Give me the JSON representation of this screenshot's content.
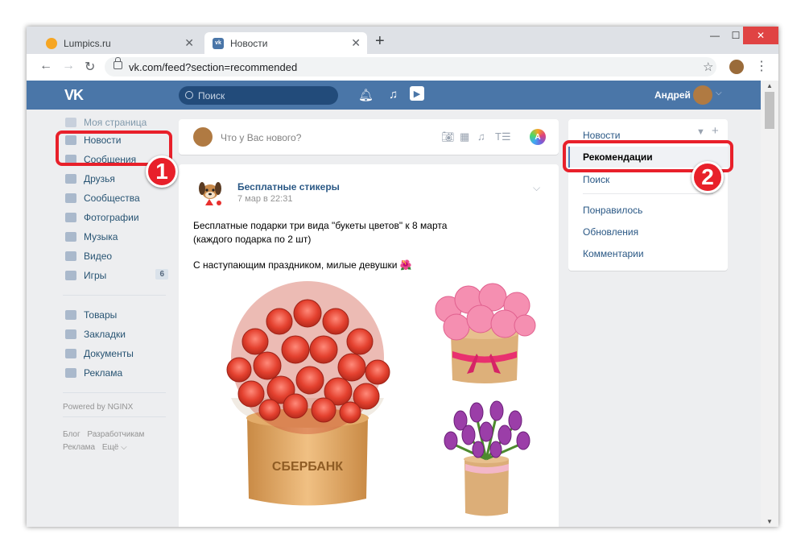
{
  "browser": {
    "tabs": [
      {
        "title": "Lumpics.ru",
        "active": false
      },
      {
        "title": "Новости",
        "active": true
      }
    ],
    "new_tab": "+",
    "close_glyph": "✕",
    "url": "vk.com/feed?section=recommended",
    "win_controls": {
      "minimize": "—",
      "maximize": "☐",
      "close": "✕"
    }
  },
  "vk_header": {
    "logo": "VK",
    "search_placeholder": "Поиск",
    "user_name": "Андрей"
  },
  "left_menu": {
    "items": [
      {
        "label": "Моя страница",
        "icon": "home-icon"
      },
      {
        "label": "Новости",
        "icon": "news-icon"
      },
      {
        "label": "Сообщения",
        "icon": "messages-icon"
      },
      {
        "label": "Друзья",
        "icon": "friends-icon"
      },
      {
        "label": "Сообщества",
        "icon": "groups-icon"
      },
      {
        "label": "Фотографии",
        "icon": "camera-icon"
      },
      {
        "label": "Музыка",
        "icon": "music-icon"
      },
      {
        "label": "Видео",
        "icon": "video-icon"
      },
      {
        "label": "Игры",
        "icon": "games-icon",
        "count": "6"
      }
    ],
    "items2": [
      {
        "label": "Товары",
        "icon": "bag-icon"
      },
      {
        "label": "Закладки",
        "icon": "star-icon"
      },
      {
        "label": "Документы",
        "icon": "document-icon"
      },
      {
        "label": "Реклама",
        "icon": "megaphone-icon"
      }
    ],
    "powered": "Powered by NGINX",
    "footer": {
      "blog": "Блог",
      "dev": "Разработчикам",
      "ads": "Реклама",
      "more": "Ещё ⌵"
    }
  },
  "composer": {
    "placeholder": "Что у Вас нового?",
    "ai_badge": "A"
  },
  "post": {
    "author": "Бесплатные стикеры",
    "date": "7 мар в 22:31",
    "line1": "Бесплатные подарки три вида \"букеты цветов\" к 8 марта",
    "line2": "(каждого подарка по 2 шт)",
    "line3": "С наступающим праздником, милые девушки 🌺",
    "box_brand": "СБЕРБАНК"
  },
  "right_menu": {
    "items": [
      "Новости",
      "Рекомендации",
      "Поиск"
    ],
    "items2": [
      "Понравилось",
      "Обновления",
      "Комментарии"
    ],
    "active": "Рекомендации"
  },
  "annotations": {
    "step1": "1",
    "step2": "2",
    "color": "#e8202a"
  },
  "colors": {
    "vk_blue": "#4a76a8",
    "link": "#2a5885"
  }
}
